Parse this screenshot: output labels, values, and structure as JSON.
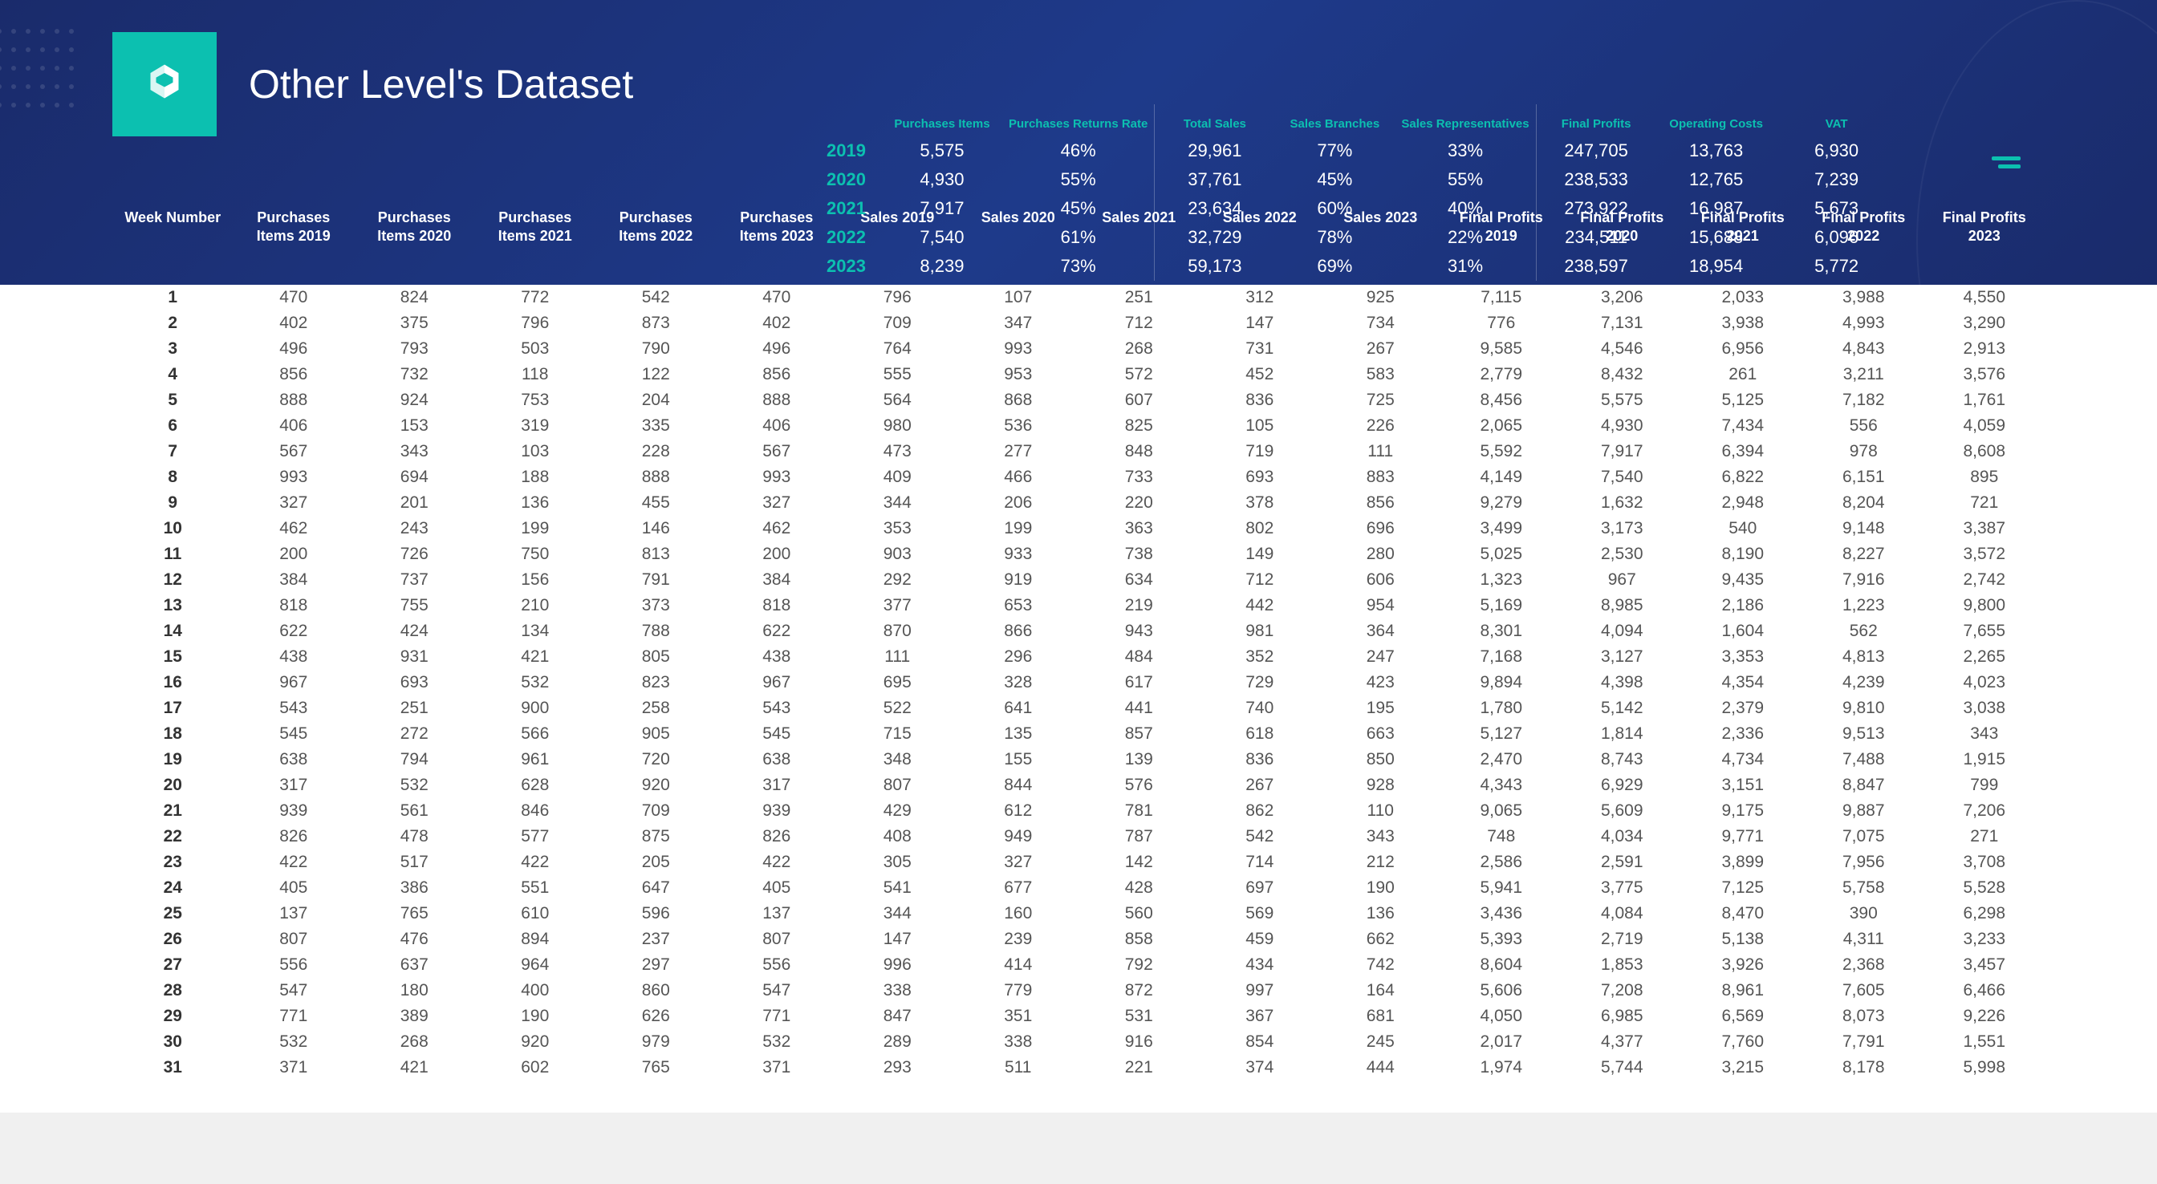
{
  "title": "Other Level's Dataset",
  "summary": {
    "years": [
      "2019",
      "2020",
      "2021",
      "2022",
      "2023"
    ],
    "metrics": [
      {
        "label": "Purchases Items",
        "vals": [
          "5,575",
          "4,930",
          "7,917",
          "7,540",
          "8,239"
        ],
        "sep": false
      },
      {
        "label": "Purchases Returns Rate",
        "vals": [
          "46%",
          "55%",
          "45%",
          "61%",
          "73%"
        ],
        "sep": false
      },
      {
        "label": "Total Sales",
        "vals": [
          "29,961",
          "37,761",
          "23,634",
          "32,729",
          "59,173"
        ],
        "sep": true
      },
      {
        "label": "Sales Branches",
        "vals": [
          "77%",
          "45%",
          "60%",
          "78%",
          "69%"
        ],
        "sep": false
      },
      {
        "label": "Sales Representatives",
        "vals": [
          "33%",
          "55%",
          "40%",
          "22%",
          "31%"
        ],
        "sep": false
      },
      {
        "label": "Final Profits",
        "vals": [
          "247,705",
          "238,533",
          "273,922",
          "234,511",
          "238,597"
        ],
        "sep": true
      },
      {
        "label": "Operating Costs",
        "vals": [
          "13,763",
          "12,765",
          "16,987",
          "15,688",
          "18,954"
        ],
        "sep": false
      },
      {
        "label": "VAT",
        "vals": [
          "6,930",
          "7,239",
          "5,673",
          "6,096",
          "5,772"
        ],
        "sep": false
      }
    ]
  },
  "columns": [
    "Week Number",
    "Purchases Items 2019",
    "Purchases Items 2020",
    "Purchases Items 2021",
    "Purchases Items 2022",
    "Purchases Items 2023",
    "Sales 2019",
    "Sales 2020",
    "Sales 2021",
    "Sales 2022",
    "Sales 2023",
    "Final Profits 2019",
    "Final Profits 2020",
    "Final Profits 2021",
    "Final Profits 2022",
    "Final Profits 2023"
  ],
  "rows": [
    [
      "1",
      "470",
      "824",
      "772",
      "542",
      "470",
      "796",
      "107",
      "251",
      "312",
      "925",
      "7,115",
      "3,206",
      "2,033",
      "3,988",
      "4,550"
    ],
    [
      "2",
      "402",
      "375",
      "796",
      "873",
      "402",
      "709",
      "347",
      "712",
      "147",
      "734",
      "776",
      "7,131",
      "3,938",
      "4,993",
      "3,290"
    ],
    [
      "3",
      "496",
      "793",
      "503",
      "790",
      "496",
      "764",
      "993",
      "268",
      "731",
      "267",
      "9,585",
      "4,546",
      "6,956",
      "4,843",
      "2,913"
    ],
    [
      "4",
      "856",
      "732",
      "118",
      "122",
      "856",
      "555",
      "953",
      "572",
      "452",
      "583",
      "2,779",
      "8,432",
      "261",
      "3,211",
      "3,576"
    ],
    [
      "5",
      "888",
      "924",
      "753",
      "204",
      "888",
      "564",
      "868",
      "607",
      "836",
      "725",
      "8,456",
      "5,575",
      "5,125",
      "7,182",
      "1,761"
    ],
    [
      "6",
      "406",
      "153",
      "319",
      "335",
      "406",
      "980",
      "536",
      "825",
      "105",
      "226",
      "2,065",
      "4,930",
      "7,434",
      "556",
      "4,059"
    ],
    [
      "7",
      "567",
      "343",
      "103",
      "228",
      "567",
      "473",
      "277",
      "848",
      "719",
      "111",
      "5,592",
      "7,917",
      "6,394",
      "978",
      "8,608"
    ],
    [
      "8",
      "993",
      "694",
      "188",
      "888",
      "993",
      "409",
      "466",
      "733",
      "693",
      "883",
      "4,149",
      "7,540",
      "6,822",
      "6,151",
      "895"
    ],
    [
      "9",
      "327",
      "201",
      "136",
      "455",
      "327",
      "344",
      "206",
      "220",
      "378",
      "856",
      "9,279",
      "1,632",
      "2,948",
      "8,204",
      "721"
    ],
    [
      "10",
      "462",
      "243",
      "199",
      "146",
      "462",
      "353",
      "199",
      "363",
      "802",
      "696",
      "3,499",
      "3,173",
      "540",
      "9,148",
      "3,387"
    ],
    [
      "11",
      "200",
      "726",
      "750",
      "813",
      "200",
      "903",
      "933",
      "738",
      "149",
      "280",
      "5,025",
      "2,530",
      "8,190",
      "8,227",
      "3,572"
    ],
    [
      "12",
      "384",
      "737",
      "156",
      "791",
      "384",
      "292",
      "919",
      "634",
      "712",
      "606",
      "1,323",
      "967",
      "9,435",
      "7,916",
      "2,742"
    ],
    [
      "13",
      "818",
      "755",
      "210",
      "373",
      "818",
      "377",
      "653",
      "219",
      "442",
      "954",
      "5,169",
      "8,985",
      "2,186",
      "1,223",
      "9,800"
    ],
    [
      "14",
      "622",
      "424",
      "134",
      "788",
      "622",
      "870",
      "866",
      "943",
      "981",
      "364",
      "8,301",
      "4,094",
      "1,604",
      "562",
      "7,655"
    ],
    [
      "15",
      "438",
      "931",
      "421",
      "805",
      "438",
      "111",
      "296",
      "484",
      "352",
      "247",
      "7,168",
      "3,127",
      "3,353",
      "4,813",
      "2,265"
    ],
    [
      "16",
      "967",
      "693",
      "532",
      "823",
      "967",
      "695",
      "328",
      "617",
      "729",
      "423",
      "9,894",
      "4,398",
      "4,354",
      "4,239",
      "4,023"
    ],
    [
      "17",
      "543",
      "251",
      "900",
      "258",
      "543",
      "522",
      "641",
      "441",
      "740",
      "195",
      "1,780",
      "5,142",
      "2,379",
      "9,810",
      "3,038"
    ],
    [
      "18",
      "545",
      "272",
      "566",
      "905",
      "545",
      "715",
      "135",
      "857",
      "618",
      "663",
      "5,127",
      "1,814",
      "2,336",
      "9,513",
      "343"
    ],
    [
      "19",
      "638",
      "794",
      "961",
      "720",
      "638",
      "348",
      "155",
      "139",
      "836",
      "850",
      "2,470",
      "8,743",
      "4,734",
      "7,488",
      "1,915"
    ],
    [
      "20",
      "317",
      "532",
      "628",
      "920",
      "317",
      "807",
      "844",
      "576",
      "267",
      "928",
      "4,343",
      "6,929",
      "3,151",
      "8,847",
      "799"
    ],
    [
      "21",
      "939",
      "561",
      "846",
      "709",
      "939",
      "429",
      "612",
      "781",
      "862",
      "110",
      "9,065",
      "5,609",
      "9,175",
      "9,887",
      "7,206"
    ],
    [
      "22",
      "826",
      "478",
      "577",
      "875",
      "826",
      "408",
      "949",
      "787",
      "542",
      "343",
      "748",
      "4,034",
      "9,771",
      "7,075",
      "271"
    ],
    [
      "23",
      "422",
      "517",
      "422",
      "205",
      "422",
      "305",
      "327",
      "142",
      "714",
      "212",
      "2,586",
      "2,591",
      "3,899",
      "7,956",
      "3,708"
    ],
    [
      "24",
      "405",
      "386",
      "551",
      "647",
      "405",
      "541",
      "677",
      "428",
      "697",
      "190",
      "5,941",
      "3,775",
      "7,125",
      "5,758",
      "5,528"
    ],
    [
      "25",
      "137",
      "765",
      "610",
      "596",
      "137",
      "344",
      "160",
      "560",
      "569",
      "136",
      "3,436",
      "4,084",
      "8,470",
      "390",
      "6,298"
    ],
    [
      "26",
      "807",
      "476",
      "894",
      "237",
      "807",
      "147",
      "239",
      "858",
      "459",
      "662",
      "5,393",
      "2,719",
      "5,138",
      "4,311",
      "3,233"
    ],
    [
      "27",
      "556",
      "637",
      "964",
      "297",
      "556",
      "996",
      "414",
      "792",
      "434",
      "742",
      "8,604",
      "1,853",
      "3,926",
      "2,368",
      "3,457"
    ],
    [
      "28",
      "547",
      "180",
      "400",
      "860",
      "547",
      "338",
      "779",
      "872",
      "997",
      "164",
      "5,606",
      "7,208",
      "8,961",
      "7,605",
      "6,466"
    ],
    [
      "29",
      "771",
      "389",
      "190",
      "626",
      "771",
      "847",
      "351",
      "531",
      "367",
      "681",
      "4,050",
      "6,985",
      "6,569",
      "8,073",
      "9,226"
    ],
    [
      "30",
      "532",
      "268",
      "920",
      "979",
      "532",
      "289",
      "338",
      "916",
      "854",
      "245",
      "2,017",
      "4,377",
      "7,760",
      "7,791",
      "1,551"
    ],
    [
      "31",
      "371",
      "421",
      "602",
      "765",
      "371",
      "293",
      "511",
      "221",
      "374",
      "444",
      "1,974",
      "5,744",
      "3,215",
      "8,178",
      "5,998"
    ]
  ]
}
